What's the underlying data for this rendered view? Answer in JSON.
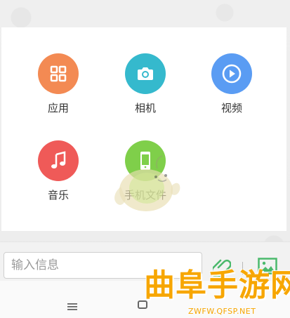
{
  "apps": [
    {
      "label": "应用",
      "icon": "grid-icon",
      "color": "#f38a53"
    },
    {
      "label": "相机",
      "icon": "camera-icon",
      "color": "#35b9cd"
    },
    {
      "label": "视频",
      "icon": "play-icon",
      "color": "#5a9cf3"
    },
    {
      "label": "音乐",
      "icon": "music-note-icon",
      "color": "#ef5a58"
    },
    {
      "label": "手机文件",
      "icon": "phone-file-icon",
      "color": "#7fcf4a"
    }
  ],
  "input": {
    "placeholder": "输入信息",
    "attach_icon": "paperclip-icon",
    "image_icon": "image-icon"
  },
  "nav": {
    "menu_icon": "menu-icon",
    "home_icon": "home-icon"
  },
  "watermark": {
    "title": "曲阜手游网",
    "url": "ZWFW.QFSP.NET",
    "color": "#f7a600"
  }
}
